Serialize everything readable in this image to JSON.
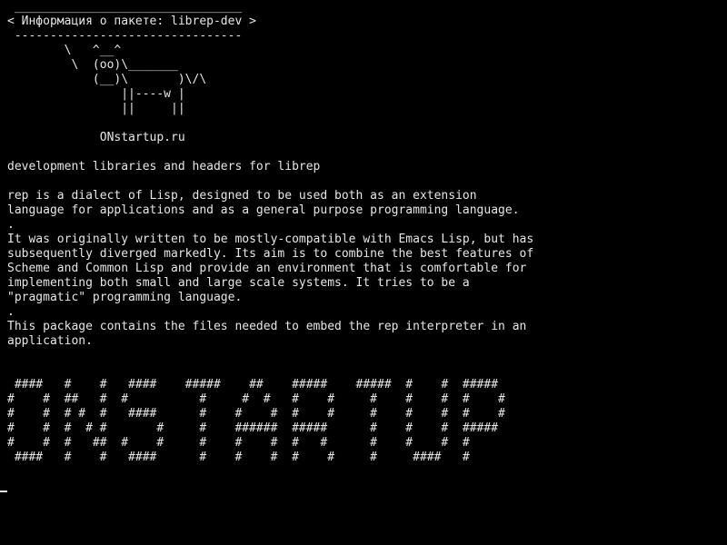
{
  "terminal": {
    "lines": [
      " ________________________________",
      "< Информация о пакете: librep-dev >",
      " --------------------------------",
      "        \\   ^__^",
      "         \\  (oo)\\_______",
      "            (__)\\       )\\/\\",
      "                ||----w |",
      "                ||     ||",
      "",
      "             ONstartup.ru",
      "",
      "development libraries and headers for librep",
      "",
      "rep is a dialect of Lisp, designed to be used both as an extension",
      "language for applications and as a general purpose programming language.",
      ".",
      "It was originally written to be mostly-compatible with Emacs Lisp, but has",
      "subsequently diverged markedly. Its aim is to combine the best features of",
      "Scheme and Common Lisp and provide an environment that is comfortable for",
      "implementing both small and large scale systems. It tries to be a",
      "\"pragmatic\" programming language.",
      ".",
      "This package contains the files needed to embed the rep interpreter in an",
      "application.",
      "",
      "",
      " ####   #    #   ####    #####    ##    #####    #####  #    #  #####",
      "#    #  ##   #  #          #     #  #   #    #     #    #    #  #    #",
      "#    #  # #  #   ####      #    #    #  #    #     #    #    #  #    #",
      "#    #  #  # #       #     #    ######  #####      #    #    #  #####",
      "#    #  #   ##  #    #     #    #    #  #   #      #    #    #  #",
      " ####   #    #   ####      #    #    #  #    #     #     ####   #"
    ]
  }
}
